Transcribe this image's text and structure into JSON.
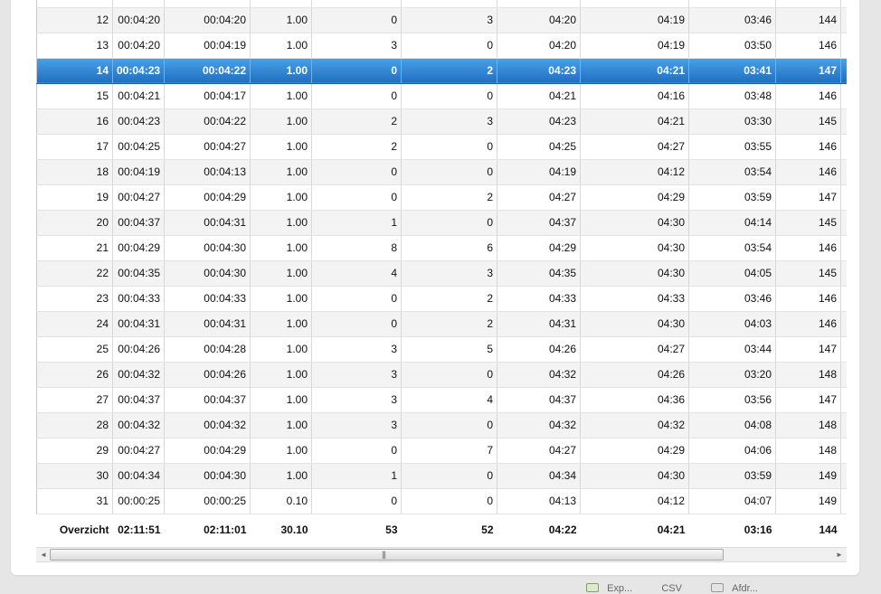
{
  "table": {
    "rows": [
      [
        "12",
        "00:04:20",
        "00:04:20",
        "1.00",
        "0",
        "3",
        "04:20",
        "04:19",
        "03:46",
        "144"
      ],
      [
        "13",
        "00:04:20",
        "00:04:19",
        "1.00",
        "3",
        "0",
        "04:20",
        "04:19",
        "03:50",
        "146"
      ],
      [
        "14",
        "00:04:23",
        "00:04:22",
        "1.00",
        "0",
        "2",
        "04:23",
        "04:21",
        "03:41",
        "147"
      ],
      [
        "15",
        "00:04:21",
        "00:04:17",
        "1.00",
        "0",
        "0",
        "04:21",
        "04:16",
        "03:48",
        "146"
      ],
      [
        "16",
        "00:04:23",
        "00:04:22",
        "1.00",
        "2",
        "3",
        "04:23",
        "04:21",
        "03:30",
        "145"
      ],
      [
        "17",
        "00:04:25",
        "00:04:27",
        "1.00",
        "2",
        "0",
        "04:25",
        "04:27",
        "03:55",
        "146"
      ],
      [
        "18",
        "00:04:19",
        "00:04:13",
        "1.00",
        "0",
        "0",
        "04:19",
        "04:12",
        "03:54",
        "146"
      ],
      [
        "19",
        "00:04:27",
        "00:04:29",
        "1.00",
        "0",
        "2",
        "04:27",
        "04:29",
        "03:59",
        "147"
      ],
      [
        "20",
        "00:04:37",
        "00:04:31",
        "1.00",
        "1",
        "0",
        "04:37",
        "04:30",
        "04:14",
        "145"
      ],
      [
        "21",
        "00:04:29",
        "00:04:30",
        "1.00",
        "8",
        "6",
        "04:29",
        "04:30",
        "03:54",
        "146"
      ],
      [
        "22",
        "00:04:35",
        "00:04:30",
        "1.00",
        "4",
        "3",
        "04:35",
        "04:30",
        "04:05",
        "145"
      ],
      [
        "23",
        "00:04:33",
        "00:04:33",
        "1.00",
        "0",
        "2",
        "04:33",
        "04:33",
        "03:46",
        "146"
      ],
      [
        "24",
        "00:04:31",
        "00:04:31",
        "1.00",
        "0",
        "2",
        "04:31",
        "04:30",
        "04:03",
        "146"
      ],
      [
        "25",
        "00:04:26",
        "00:04:28",
        "1.00",
        "3",
        "5",
        "04:26",
        "04:27",
        "03:44",
        "147"
      ],
      [
        "26",
        "00:04:32",
        "00:04:26",
        "1.00",
        "3",
        "0",
        "04:32",
        "04:26",
        "03:20",
        "148"
      ],
      [
        "27",
        "00:04:37",
        "00:04:37",
        "1.00",
        "3",
        "4",
        "04:37",
        "04:36",
        "03:56",
        "147"
      ],
      [
        "28",
        "00:04:32",
        "00:04:32",
        "1.00",
        "3",
        "0",
        "04:32",
        "04:32",
        "04:08",
        "148"
      ],
      [
        "29",
        "00:04:27",
        "00:04:29",
        "1.00",
        "0",
        "7",
        "04:27",
        "04:29",
        "04:06",
        "148"
      ],
      [
        "30",
        "00:04:34",
        "00:04:30",
        "1.00",
        "1",
        "0",
        "04:34",
        "04:30",
        "03:59",
        "149"
      ],
      [
        "31",
        "00:00:25",
        "00:00:25",
        "0.10",
        "0",
        "0",
        "04:13",
        "04:12",
        "04:07",
        "149"
      ]
    ],
    "selected_row": "14",
    "summary": [
      "Overzicht",
      "02:11:51",
      "02:11:01",
      "30.10",
      "53",
      "52",
      "04:22",
      "04:21",
      "03:16",
      "144"
    ]
  },
  "scrollbar": {
    "left_arrow": "◄",
    "right_arrow": "►",
    "grip": "|||"
  },
  "footer": {
    "excel_label": "Exp...",
    "csv_label": "CSV",
    "print_label": "Afdr..."
  },
  "colors": {
    "selected_row": "#2f86d6",
    "row_alt": "#f3f3f3",
    "background": "#e6e6e6"
  }
}
